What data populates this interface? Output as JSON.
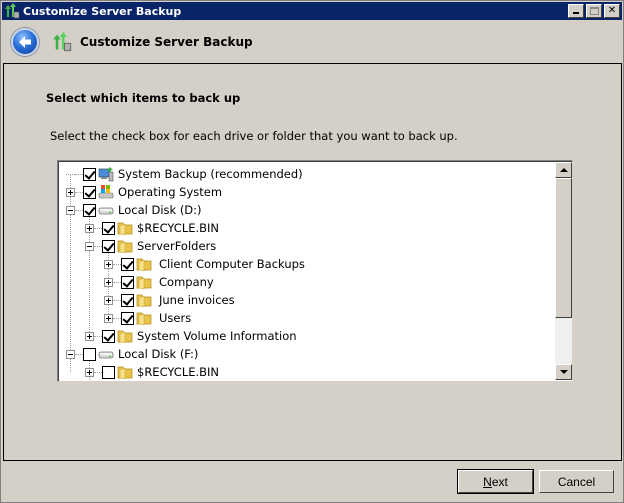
{
  "window": {
    "title": "Customize Server Backup",
    "controls": [
      "minimize",
      "maximize",
      "close"
    ]
  },
  "header": {
    "title": "Customize Server Backup",
    "back_icon": "back-arrow-icon",
    "app_icon": "server-backup-icon"
  },
  "content": {
    "section_title": "Select which items to back up",
    "instruction": "Select the check box for each drive or folder that you want to back up."
  },
  "tree": {
    "items": [
      {
        "label": "System Backup (recommended)",
        "level": 0,
        "expander": "none",
        "checked": true,
        "icon": "system-backup-icon"
      },
      {
        "label": "Operating System",
        "level": 0,
        "expander": "plus",
        "checked": true,
        "icon": "operating-system-icon"
      },
      {
        "label": "Local Disk (D:)",
        "level": 0,
        "expander": "minus",
        "checked": true,
        "icon": "drive-icon"
      },
      {
        "label": "$RECYCLE.BIN",
        "level": 1,
        "expander": "plus",
        "checked": true,
        "icon": "folder-icon"
      },
      {
        "label": "ServerFolders",
        "level": 1,
        "expander": "minus",
        "checked": true,
        "icon": "folder-icon"
      },
      {
        "label": "Client Computer Backups",
        "level": 2,
        "expander": "plus",
        "checked": true,
        "icon": "folder-icon"
      },
      {
        "label": "Company",
        "level": 2,
        "expander": "plus",
        "checked": true,
        "icon": "folder-icon"
      },
      {
        "label": "June invoices",
        "level": 2,
        "expander": "plus",
        "checked": true,
        "icon": "folder-icon"
      },
      {
        "label": "Users",
        "level": 2,
        "expander": "plus",
        "checked": true,
        "icon": "folder-icon"
      },
      {
        "label": "System Volume Information",
        "level": 1,
        "expander": "plus",
        "checked": true,
        "icon": "folder-icon"
      },
      {
        "label": "Local Disk (F:)",
        "level": 0,
        "expander": "minus",
        "checked": false,
        "icon": "drive-icon"
      },
      {
        "label": "$RECYCLE.BIN",
        "level": 1,
        "expander": "plus",
        "checked": false,
        "icon": "folder-icon"
      }
    ]
  },
  "buttons": {
    "next_label": "Next",
    "next_accel": "N",
    "next_rest": "ext",
    "cancel_label": "Cancel"
  },
  "colors": {
    "titlebar": "#0a246a",
    "dialog_bg": "#d4d0c8",
    "tree_bg": "#ffffff"
  }
}
